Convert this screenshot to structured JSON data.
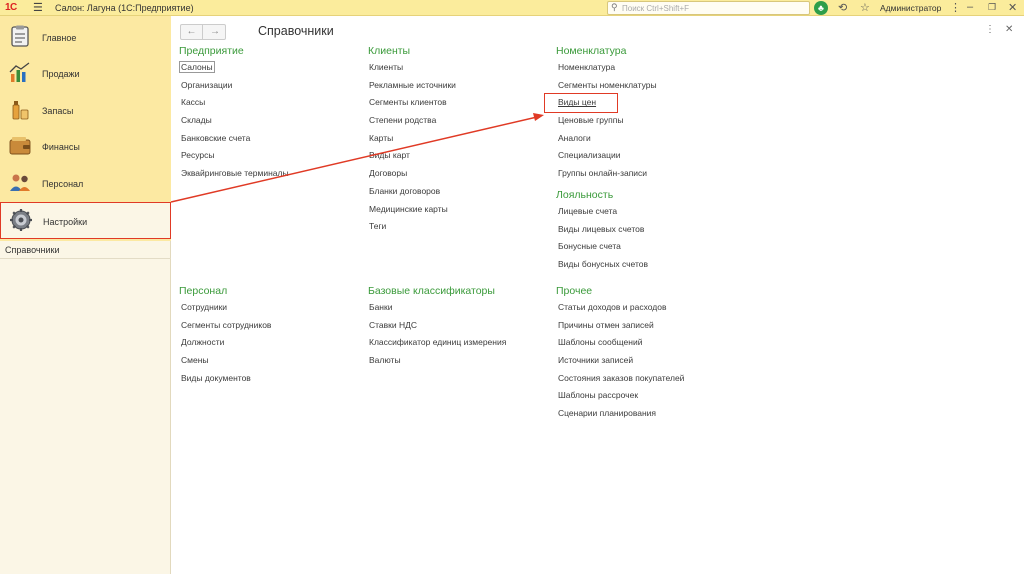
{
  "app": {
    "logo": "1С",
    "title": "Салон: Лагуна  (1С:Предприятие)",
    "search_placeholder": "Поиск Ctrl+Shift+F",
    "user": "Администратор"
  },
  "sections": [
    {
      "label": "Главное",
      "icon": "clipboard-icon"
    },
    {
      "label": "Продажи",
      "icon": "sales-chart-icon"
    },
    {
      "label": "Запасы",
      "icon": "stock-icon"
    },
    {
      "label": "Финансы",
      "icon": "wallet-icon"
    },
    {
      "label": "Персонал",
      "icon": "people-icon"
    },
    {
      "label": "Настройки",
      "icon": "gear-icon"
    }
  ],
  "sub_item": "Справочники",
  "page": {
    "title": "Справочники"
  },
  "groups": {
    "enterprise": {
      "title": "Предприятие",
      "links": [
        "Салоны",
        "Организации",
        "Кассы",
        "Склады",
        "Банковские счета",
        "Ресурсы",
        "Эквайринговые терминалы"
      ]
    },
    "clients": {
      "title": "Клиенты",
      "links": [
        "Клиенты",
        "Рекламные источники",
        "Сегменты клиентов",
        "Степени родства",
        "Карты",
        "Виды карт",
        "Договоры",
        "Бланки договоров",
        "Медицинские карты",
        "Теги"
      ]
    },
    "nomenclature": {
      "title": "Номенклатура",
      "links": [
        "Номенклатура",
        "Сегменты номенклатуры",
        "Виды цен",
        "Ценовые группы",
        "Аналоги",
        "Специализации",
        "Группы онлайн-записи"
      ]
    },
    "loyalty": {
      "title": "Лояльность",
      "links": [
        "Лицевые счета",
        "Виды лицевых счетов",
        "Бонусные счета",
        "Виды бонусных счетов"
      ]
    },
    "personnel": {
      "title": "Персонал",
      "links": [
        "Сотрудники",
        "Сегменты сотрудников",
        "Должности",
        "Смены",
        "Виды документов"
      ]
    },
    "classifiers": {
      "title": "Базовые классификаторы",
      "links": [
        "Банки",
        "Ставки НДС",
        "Классификатор единиц измерения",
        "Валюты"
      ]
    },
    "other": {
      "title": "Прочее",
      "links": [
        "Статьи доходов и расходов",
        "Причины отмен записей",
        "Шаблоны сообщений",
        "Источники записей",
        "Состояния заказов покупателей",
        "Шаблоны рассрочек",
        "Сценарии планирования"
      ]
    }
  },
  "colors": {
    "titlebar": "#fbec9c",
    "sidebar_sections": "#fce9a2",
    "group_title": "#3a9a3a",
    "highlight": "#e03a25"
  }
}
